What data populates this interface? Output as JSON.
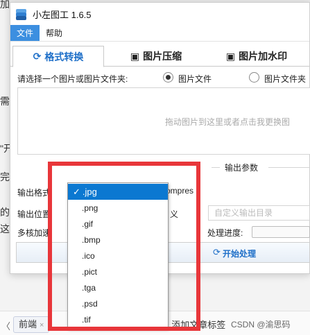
{
  "background": {
    "fragments": [
      "加",
      "需",
      "\"开",
      "完",
      "的",
      "这"
    ],
    "chips": [
      {
        "label": "前端",
        "close": "×"
      }
    ],
    "add_tag": "+ 添加文章标签",
    "watermark": "CSDN @渝思码"
  },
  "window": {
    "title": "小左图工 1.6.5",
    "menu": [
      "文件",
      "帮助"
    ],
    "tabs": [
      {
        "label": "格式转换",
        "icon": "refresh-icon"
      },
      {
        "label": "图片压缩",
        "icon": "image-icon"
      },
      {
        "label": "图片加水印",
        "icon": "image-icon"
      }
    ],
    "choose_label": "请选择一个图片或图片文件夹:",
    "radio_options": [
      "图片文件",
      "图片文件夹"
    ],
    "dropzone_hint": "拖动图片到这里或者点击我更换图",
    "section_title": "输出参数",
    "output_format_label": "输出格式",
    "compress_fragment": "ompres",
    "output_location_label": "输出位置",
    "custom_fragment": "义",
    "output_dir_placeholder": "自定义输出目录",
    "multicore_label": "多核加速",
    "progress_label": "处理进度:",
    "start_button": "开始处理"
  },
  "dropdown": {
    "check": "✓",
    "selected": ".jpg",
    "options": [
      ".jpg",
      ".png",
      ".gif",
      ".bmp",
      ".ico",
      ".pict",
      ".tga",
      ".psd",
      ".tif"
    ]
  },
  "colors": {
    "accent": "#1e6fc8",
    "menu_active": "#3c8fe0",
    "selection": "#0b78d1",
    "highlight": "#e8363a"
  }
}
